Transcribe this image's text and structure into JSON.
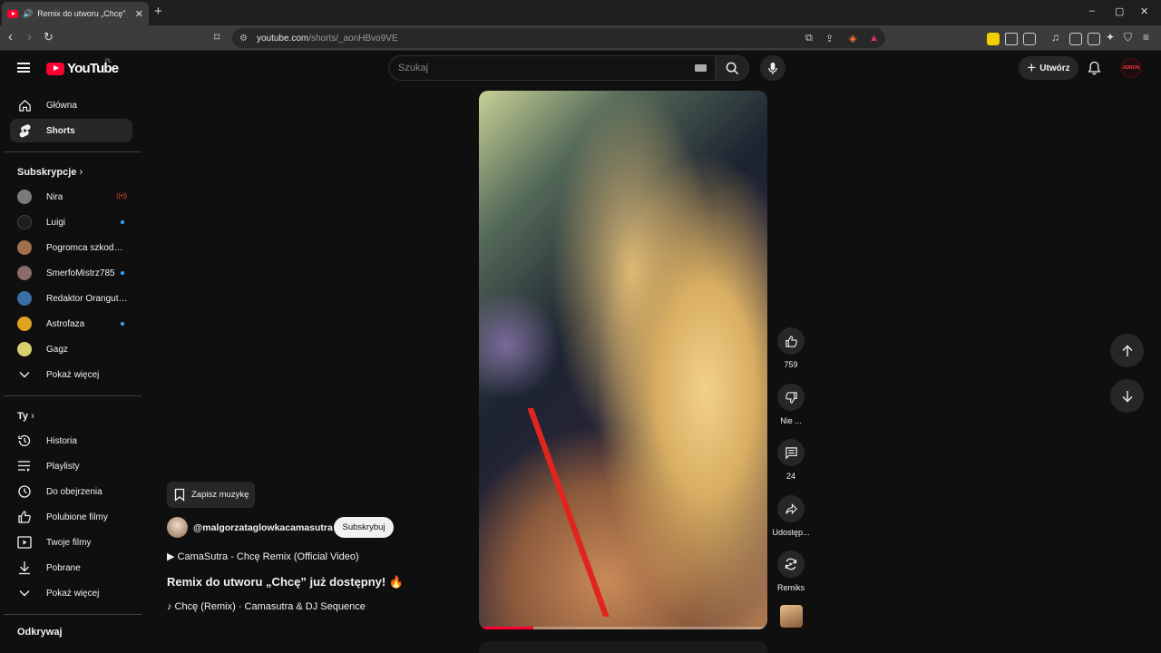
{
  "browser": {
    "tab_title": "Remix do utworu „Chcę” już d",
    "url_host": "youtube.com",
    "url_path": "/shorts/_aonHBvo9VE",
    "window_controls": [
      "–",
      "▢",
      "✕"
    ]
  },
  "header": {
    "logo_text": "YouTube",
    "country_code": "PL",
    "search_placeholder": "Szukaj",
    "create_label": "Utwórz",
    "avatar_text": "ADRON"
  },
  "sidebar": {
    "main_items": [
      {
        "label": "Główna",
        "icon": "home-icon"
      },
      {
        "label": "Shorts",
        "icon": "shorts-icon",
        "active": true
      }
    ],
    "subscriptions_heading": "Subskrypcje",
    "subscriptions": [
      {
        "label": "Nira",
        "status": "live",
        "avatar_color": "#7a7a7a"
      },
      {
        "label": "Luigi",
        "status": "new",
        "avatar_color": "#1d1d1d"
      },
      {
        "label": "Pogromca szkodni...",
        "status": "",
        "avatar_color": "#a0704a"
      },
      {
        "label": "SmerfoMistrz785",
        "status": "new",
        "avatar_color": "#8a6a6a"
      },
      {
        "label": "Redaktor Orangutan",
        "status": "",
        "avatar_color": "#3a6ea5"
      },
      {
        "label": "Astrofaza",
        "status": "new",
        "avatar_color": "#e0a020"
      },
      {
        "label": "Gagz",
        "status": "",
        "avatar_color": "#d8d070"
      }
    ],
    "show_more_label": "Pokaż więcej",
    "you_heading": "Ty",
    "you_items": [
      {
        "label": "Historia",
        "icon": "history-icon"
      },
      {
        "label": "Playlisty",
        "icon": "playlists-icon"
      },
      {
        "label": "Do obejrzenia",
        "icon": "watch-later-icon"
      },
      {
        "label": "Polubione filmy",
        "icon": "liked-icon"
      },
      {
        "label": "Twoje filmy",
        "icon": "your-videos-icon"
      },
      {
        "label": "Pobrane",
        "icon": "downloads-icon"
      }
    ],
    "you_show_more_label": "Pokaż więcej",
    "explore_heading": "Odkrywaj"
  },
  "short": {
    "save_music_label": "Zapisz muzykę",
    "channel_handle": "@malgorzataglowkacamasutra",
    "subscribe_label": "Subskrybuj",
    "linked_video": "▶ CamaSutra - Chcę Remix (Official Video)",
    "title": "Remix do utworu „Chcę” już dostępny! 🔥",
    "sound": "♪ Chcę (Remix) · Camasutra & DJ Sequence",
    "progress_fraction": 0.19
  },
  "actions": {
    "like_count": "759",
    "dislike_label": "Nie ...",
    "comment_count": "24",
    "share_label": "Udostęp...",
    "remix_label": "Remiks"
  },
  "colors": {
    "accent": "#ff0033",
    "background": "#0f0f0f",
    "chip": "#272727",
    "new_dot": "#3ea6ff"
  }
}
